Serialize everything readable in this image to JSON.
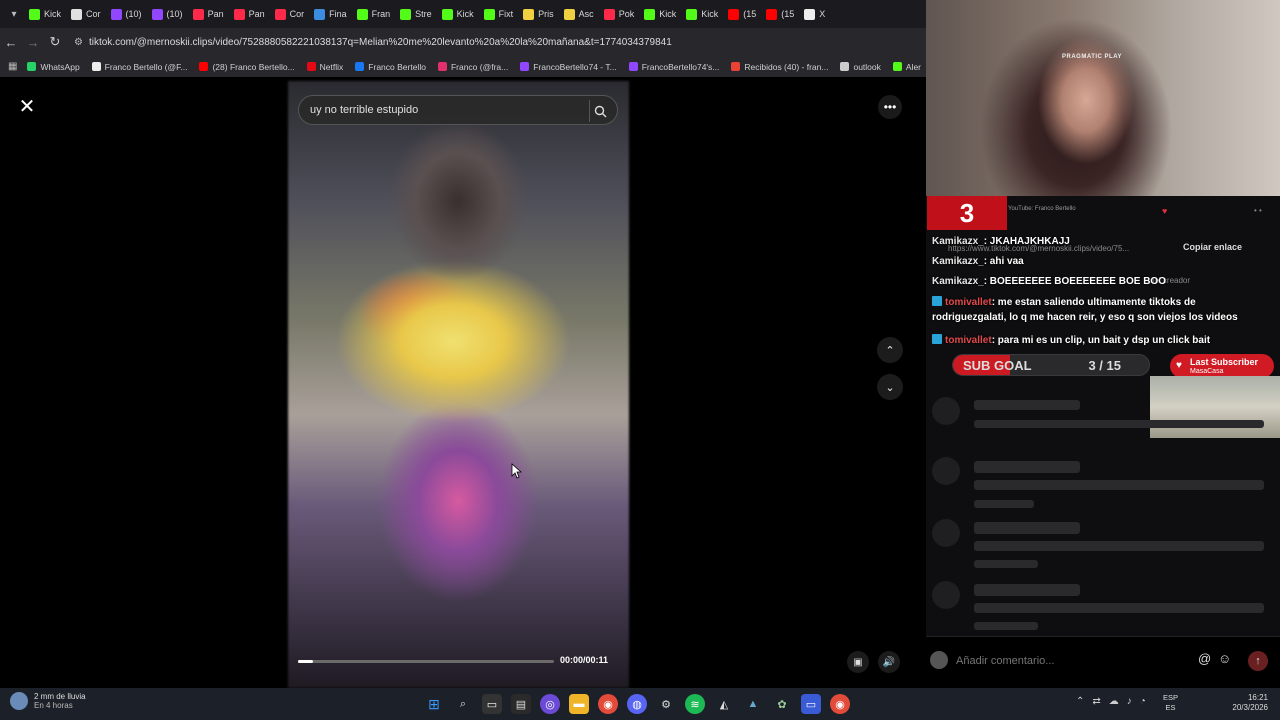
{
  "browser": {
    "tabs": [
      {
        "label": "Kick",
        "color": "#53fc18"
      },
      {
        "label": "Cor",
        "color": "#e0e0e0"
      },
      {
        "label": "(10)",
        "color": "#9146ff"
      },
      {
        "label": "(10)",
        "color": "#9146ff"
      },
      {
        "label": "Pan",
        "color": "#ff2a4a"
      },
      {
        "label": "Pan",
        "color": "#ff2a4a"
      },
      {
        "label": "Cor",
        "color": "#ff2a4a"
      },
      {
        "label": "Fina",
        "color": "#3a8de0"
      },
      {
        "label": "Fran",
        "color": "#53fc18"
      },
      {
        "label": "Stre",
        "color": "#53fc18"
      },
      {
        "label": "Kick",
        "color": "#53fc18"
      },
      {
        "label": "Fixt",
        "color": "#53fc18"
      },
      {
        "label": "Pris",
        "color": "#f0d040"
      },
      {
        "label": "Asc",
        "color": "#f0d040"
      },
      {
        "label": "Pok",
        "color": "#ff2a4a"
      },
      {
        "label": "Kick",
        "color": "#53fc18"
      },
      {
        "label": "Kick",
        "color": "#53fc18"
      },
      {
        "label": "(15",
        "color": "#ff0000"
      },
      {
        "label": "(15",
        "color": "#ff0000"
      },
      {
        "label": "X",
        "color": "#eeeeee"
      }
    ],
    "url": "tiktok.com/@mernoskii.clips/video/7528880582221038137q=Melian%20me%20levanto%20a%20la%20mañana&t=1774034379841",
    "bookmarks": [
      {
        "label": "WhatsApp",
        "color": "#25d366"
      },
      {
        "label": "Franco Bertello (@F...",
        "color": "#eeeeee"
      },
      {
        "label": "(28) Franco Bertello...",
        "color": "#ff0000"
      },
      {
        "label": "Netflix",
        "color": "#e50914"
      },
      {
        "label": "Franco Bertello",
        "color": "#1877f2"
      },
      {
        "label": "Franco (@fra...",
        "color": "#e1306c"
      },
      {
        "label": "FrancoBertello74 - T...",
        "color": "#9146ff"
      },
      {
        "label": "FrancoBertello74's...",
        "color": "#9146ff"
      },
      {
        "label": "Recibidos (40) - fran...",
        "color": "#ea4335"
      },
      {
        "label": "outlook",
        "color": "#cccccc"
      },
      {
        "label": "Aler",
        "color": "#53fc18"
      }
    ]
  },
  "video": {
    "search_value": "uy no terrible estupido",
    "time": "00:00/00:11",
    "progress": 0.06
  },
  "stream": {
    "logo_text": "3",
    "youtube_line": "YouTube: Franco Bertello",
    "link": "https://www.tiktok.com/@mernoskii.clips/video/75...",
    "copy_label": "Copiar enlace",
    "creator_label": "del creador",
    "chat": [
      {
        "user": "Kamikazx_",
        "text": ": JKAHAJKHKAJJ",
        "twitch": false
      },
      {
        "user": "Kamikazx_",
        "text": ": ahi vaa",
        "twitch": false
      },
      {
        "user": "Kamikazx_",
        "text": ": BOEEEEEEE BOEEEEEEE BOE BOO",
        "twitch": false
      },
      {
        "user": "tomivallet",
        "text": ": me estan saliendo ultimamente tiktoks de rodriguezgalati, lo q me hacen reir, y eso q son viejos los videos",
        "twitch": true
      },
      {
        "user": "tomivallet",
        "text": ": para mi es un clip, un bait y dsp un click bait",
        "twitch": true
      }
    ],
    "goal_label": "SUB GOAL",
    "goal_count": "3 / 15",
    "goal_current": 3,
    "goal_target": 15,
    "last_sub_title": "Last Subscriber",
    "last_sub_name": "MasaCasa",
    "cam_brand": "PRAGMATIC PLAY"
  },
  "comment": {
    "placeholder": "Añadir comentario..."
  },
  "taskbar": {
    "weather_line1": "2 mm de lluvia",
    "weather_line2": "En 4 horas",
    "lang1": "ESP",
    "lang2": "ES",
    "time": "16:21",
    "date": "20/3/2026"
  }
}
